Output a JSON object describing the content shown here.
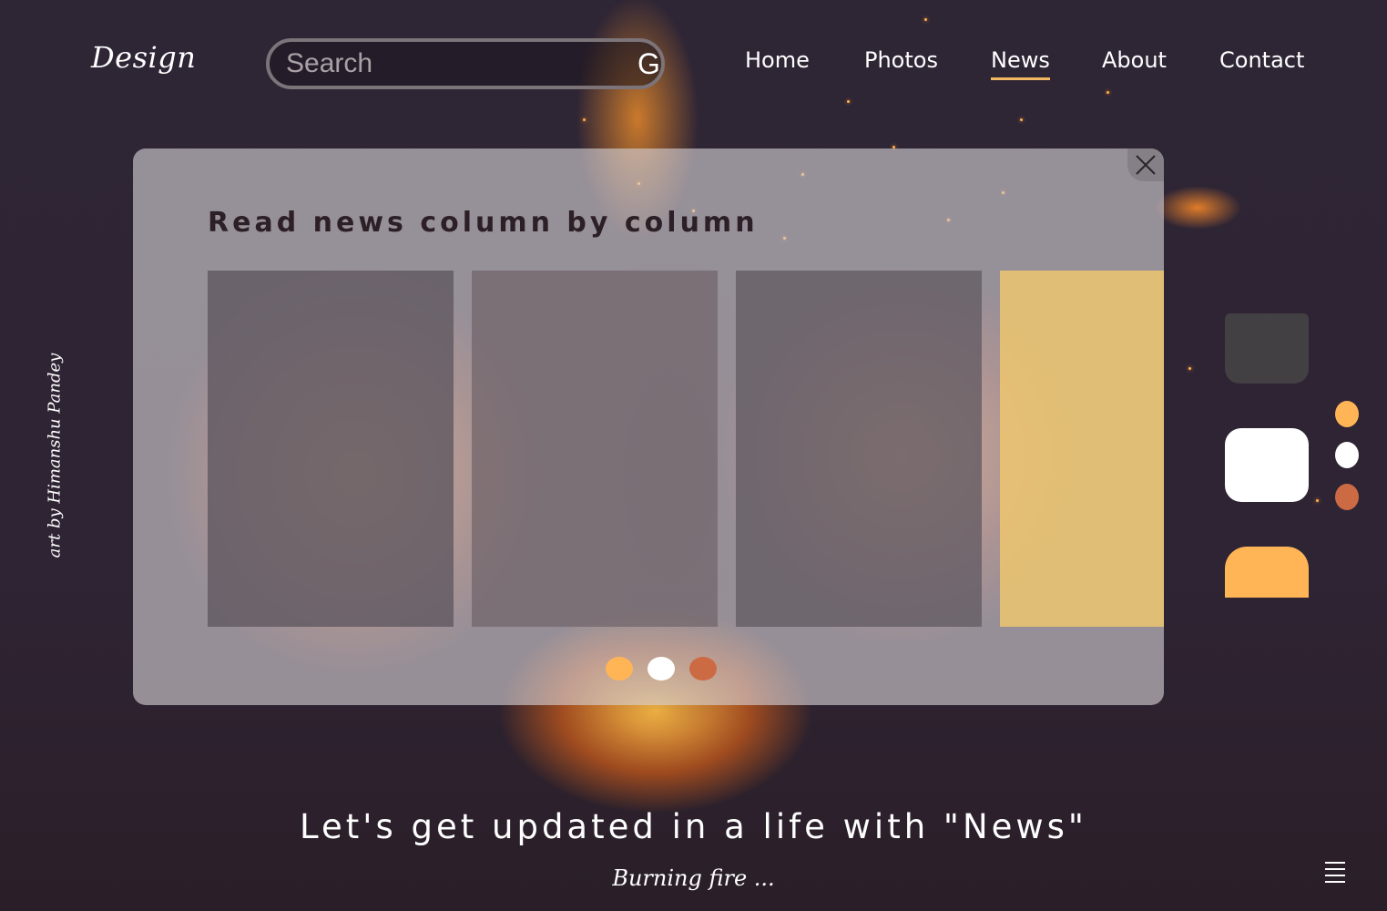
{
  "header": {
    "logo": "Design",
    "search": {
      "placeholder": "Search",
      "value": "",
      "button_label": "Go"
    },
    "nav": [
      {
        "label": "Home",
        "active": false
      },
      {
        "label": "Photos",
        "active": false
      },
      {
        "label": "News",
        "active": true
      },
      {
        "label": "About",
        "active": false
      },
      {
        "label": "Contact",
        "active": false
      }
    ]
  },
  "modal": {
    "title": "Read news column by column",
    "close_icon": "close-icon",
    "carousel_dots": [
      "#ffb556",
      "#ffffff",
      "#cc6b43"
    ]
  },
  "sidebar_credit": "art by Himanshu Pandey",
  "palette": {
    "swatches": [
      "#434044",
      "#ffffff",
      "#ffb556"
    ],
    "mini_dots": [
      "#ffb556",
      "#ffffff",
      "#cc6b43"
    ]
  },
  "footer": {
    "tagline": "Let's get updated in a life with \"News\"",
    "subline": "Burning fire ...",
    "menu_icon": "hamburger-menu-icon"
  }
}
